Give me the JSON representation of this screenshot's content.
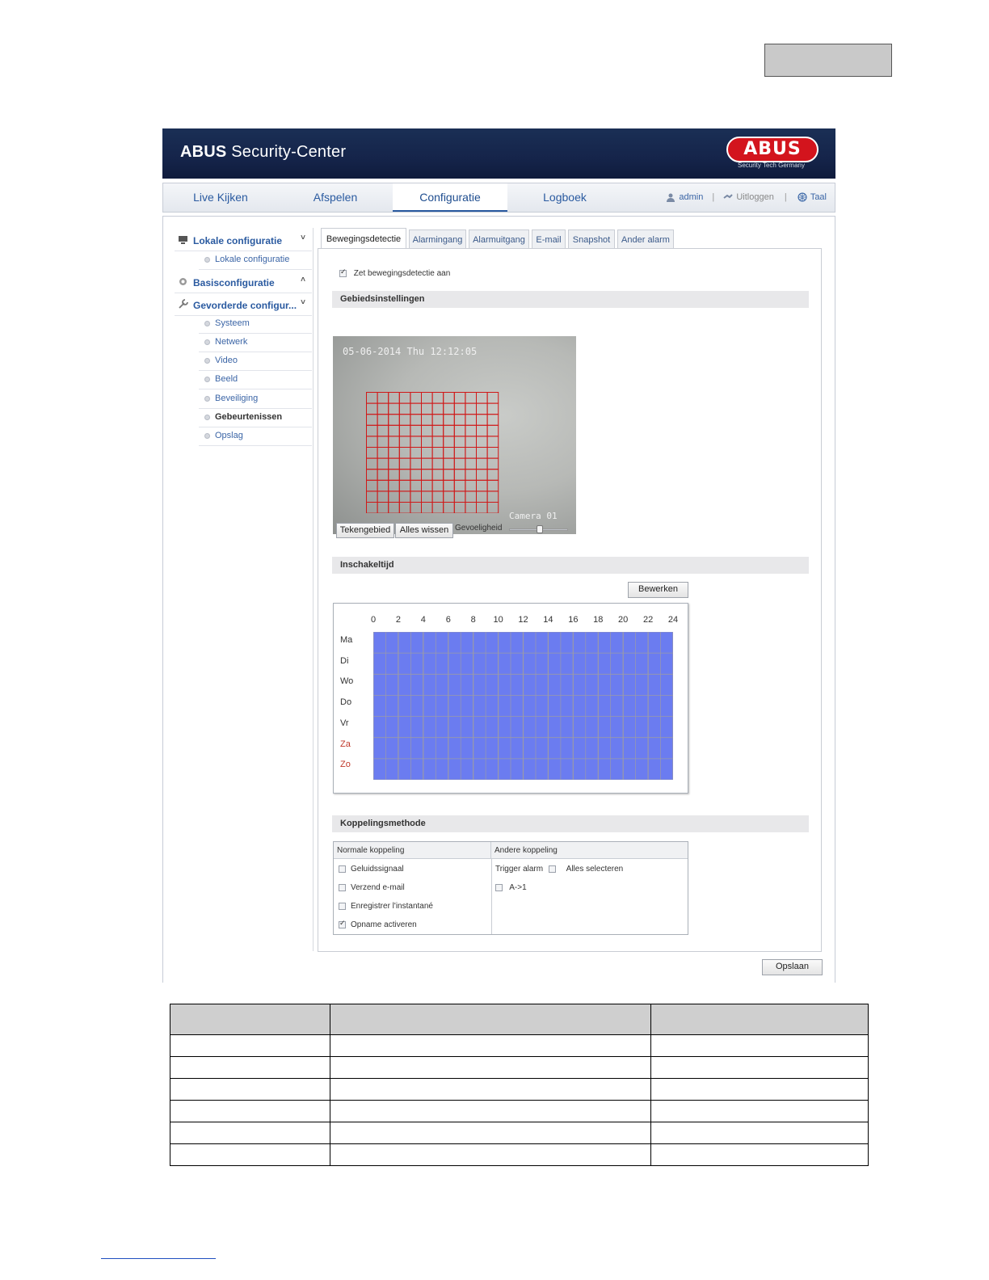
{
  "app": {
    "brand_bold": "ABUS",
    "brand_rest": " Security-Center",
    "logo_text": "ABUS",
    "logo_tagline": "Security Tech Germany"
  },
  "nav": {
    "tabs": [
      "Live Kijken",
      "Afspelen",
      "Configuratie",
      "Logboek"
    ],
    "active_tab": "Configuratie",
    "user": "admin",
    "logout": "Uitloggen",
    "language": "Taal"
  },
  "sidebar": {
    "sections": [
      {
        "label": "Lokale configuratie",
        "chevron": "˅",
        "items": [
          "Lokale configuratie"
        ]
      },
      {
        "label": "Basisconfiguratie",
        "chevron": "˄",
        "items": []
      },
      {
        "label": "Gevorderde configur...",
        "chevron": "˅",
        "items": [
          "Systeem",
          "Netwerk",
          "Video",
          "Beeld",
          "Beveiliging",
          "Gebeurtenissen",
          "Opslag"
        ]
      }
    ],
    "active_item": "Gebeurtenissen"
  },
  "tabs": [
    "Bewegingsdetectie",
    "Alarmingang",
    "Alarmuitgang",
    "E-mail",
    "Snapshot",
    "Ander alarm"
  ],
  "motion": {
    "enable_label": "Zet bewegingsdetectie aan",
    "enabled": true,
    "area_title": "Gebiedsinstellingen",
    "timestamp": "05-06-2014 Thu 12:12:05",
    "camera_label": "Camera 01",
    "draw_button": "Tekengebied",
    "clear_button": "Alles wissen",
    "sensitivity_label": "Gevoeligheid",
    "sensitivity_level": 0.5
  },
  "schedule": {
    "title": "Inschakeltijd",
    "edit_button": "Bewerken",
    "hours": [
      "0",
      "2",
      "4",
      "6",
      "8",
      "10",
      "12",
      "14",
      "16",
      "18",
      "20",
      "22",
      "24"
    ],
    "days": [
      "Ma",
      "Di",
      "Wo",
      "Do",
      "Vr",
      "Za",
      "Zo"
    ],
    "weekend_days": [
      "Za",
      "Zo"
    ],
    "fill_color": "#6b7cf0"
  },
  "linkage": {
    "title": "Koppelingsmethode",
    "normal_header": "Normale koppeling",
    "other_header": "Andere koppeling",
    "normal_options": [
      {
        "label": "Geluidssignaal",
        "checked": false
      },
      {
        "label": "Verzend e-mail",
        "checked": false
      },
      {
        "label": "Enregistrer l'instantané",
        "checked": false
      },
      {
        "label": "Opname activeren",
        "checked": true
      }
    ],
    "trigger_alarm_label": "Trigger alarm",
    "select_all_label": "Alles selecteren",
    "output_label": "A->1"
  },
  "save_button": "Opslaan",
  "colors": {
    "header_bg": "#15244a",
    "accent": "#2a5aa0",
    "logo_red": "#d3141d",
    "motion_grid": "#d01818"
  }
}
